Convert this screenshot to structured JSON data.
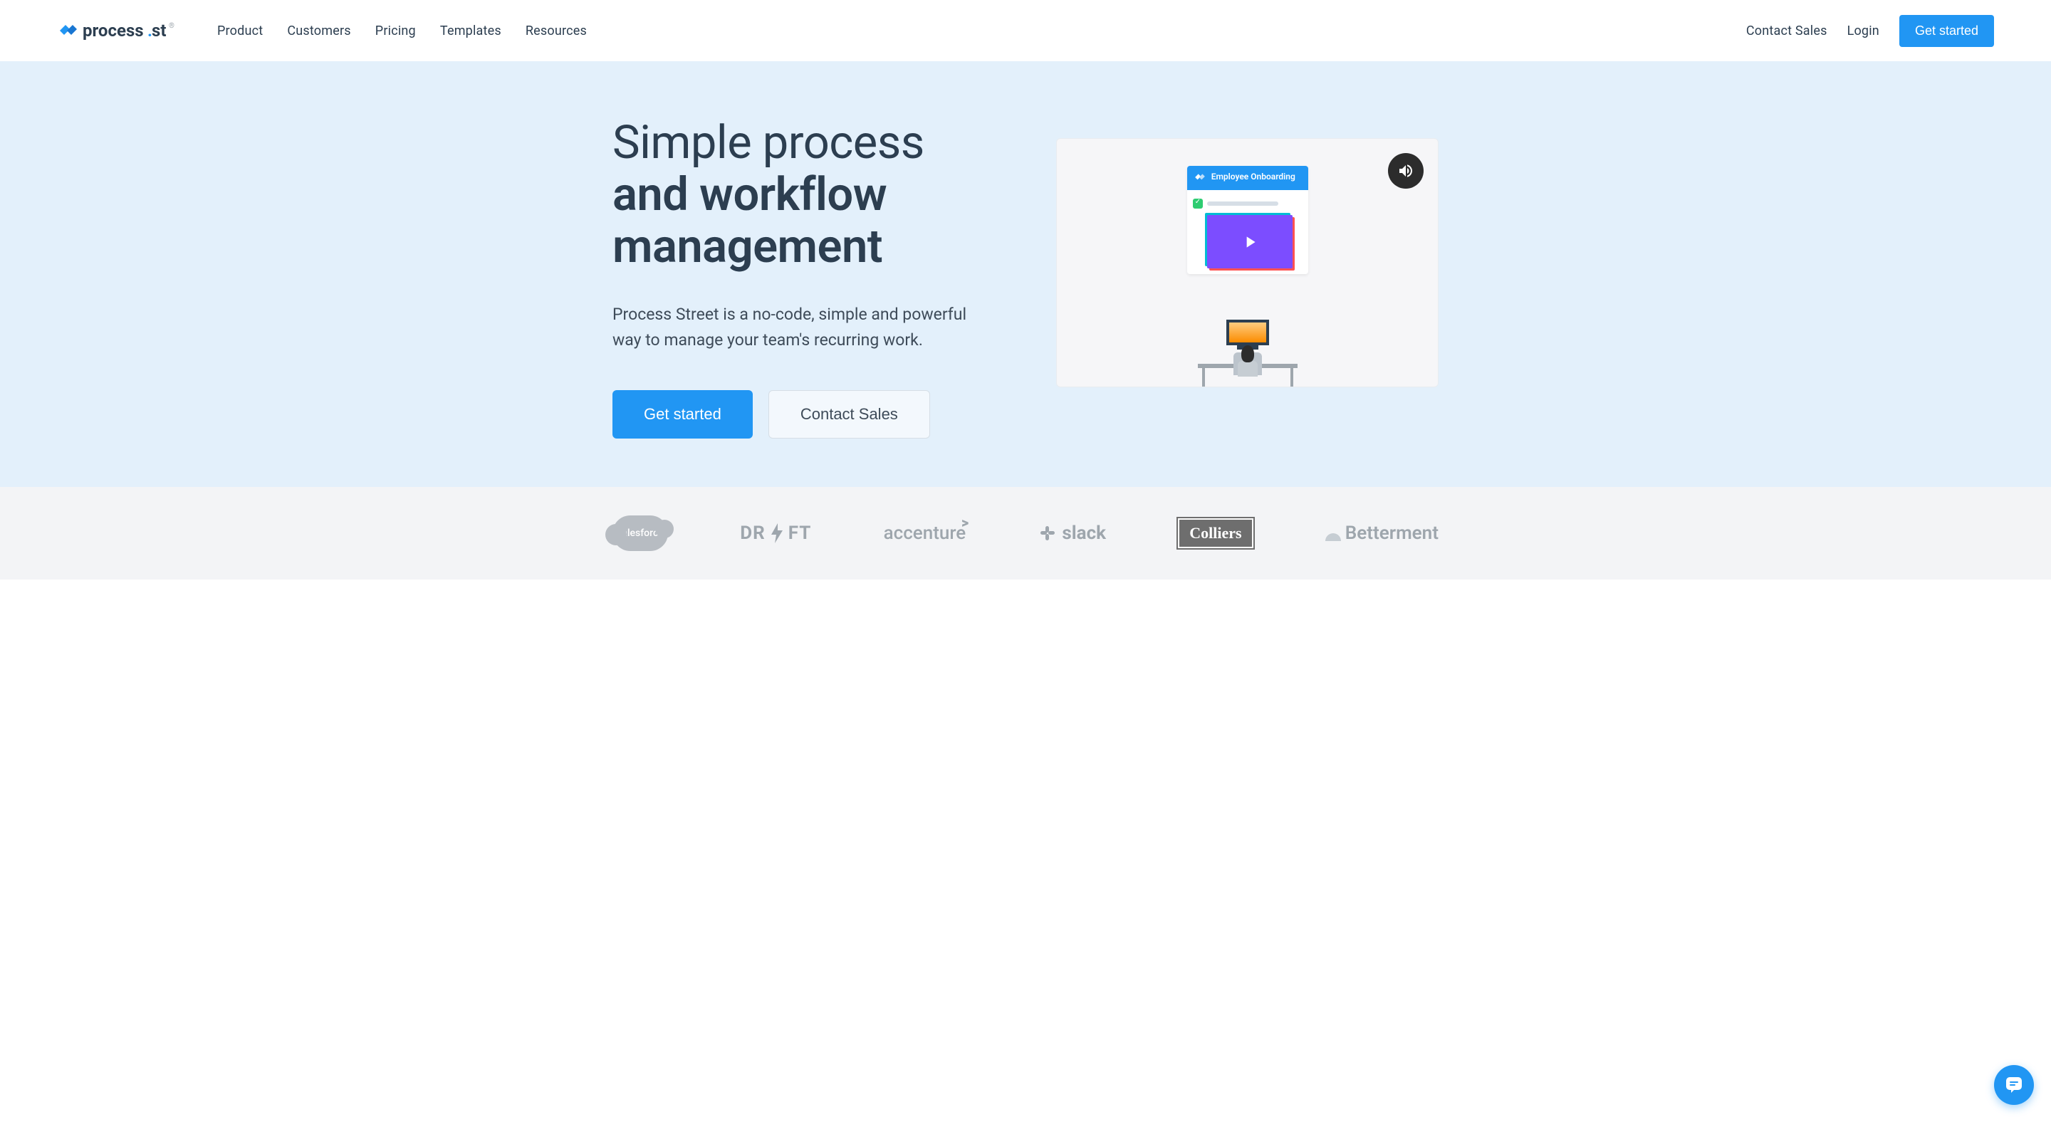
{
  "logo": {
    "brand": "process.st"
  },
  "nav": {
    "items": [
      "Product",
      "Customers",
      "Pricing",
      "Templates",
      "Resources"
    ],
    "contact": "Contact Sales",
    "login": "Login",
    "cta": "Get started"
  },
  "hero": {
    "title_line1": "Simple process",
    "title_line2": "and workflow management",
    "subtitle": "Process Street is a no-code, simple and powerful way to manage your team's recurring work.",
    "primary_btn": "Get started",
    "secondary_btn": "Contact Sales"
  },
  "video": {
    "board_title": "Employee Onboarding"
  },
  "customers": {
    "logos": [
      "salesforce",
      "DRIFT",
      "accenture",
      "slack",
      "Colliers",
      "Betterment"
    ]
  }
}
